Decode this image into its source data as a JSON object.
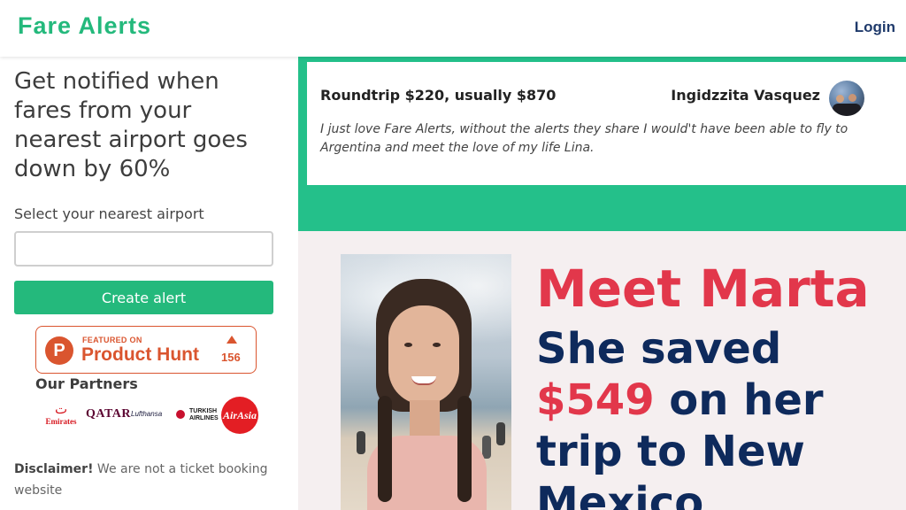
{
  "header": {
    "logo": "Fare Alerts",
    "login": "Login"
  },
  "signup": {
    "headline": "Get notified when fares from your nearest airport goes down by 60%",
    "airport_label": "Select your nearest airport",
    "airport_value": "",
    "create_button": "Create alert"
  },
  "product_hunt": {
    "featured": "FEATURED ON",
    "name": "Product Hunt",
    "votes": "156",
    "logo_letter": "P"
  },
  "partners": {
    "title": "Our Partners",
    "items": [
      "Emirates",
      "QATAR",
      "Lufthansa",
      "TURKISH AIRLINES",
      "AirAsia"
    ],
    "emirates_glyph": "ت"
  },
  "disclaimer": {
    "bold": "Disclaimer!",
    "text": " We are not a ticket booking website"
  },
  "testimonial": {
    "deal": "Roundtrip $220, usually $870",
    "author": "Ingidzzita Vasquez",
    "quote": "I just love Fare Alerts, without the alerts they share I would't have been able to fly to Argentina and meet the love of my life Lina."
  },
  "story": {
    "meet": "Meet Marta",
    "saved_prefix": "She saved ",
    "saved_amount": "$549",
    "saved_suffix": " on her trip to New Mexico"
  },
  "colors": {
    "brand_green": "#24b97c",
    "band_green": "#24c08a",
    "accent_red": "#e2374b",
    "navy": "#0e2a5c",
    "product_hunt": "#da552f"
  }
}
